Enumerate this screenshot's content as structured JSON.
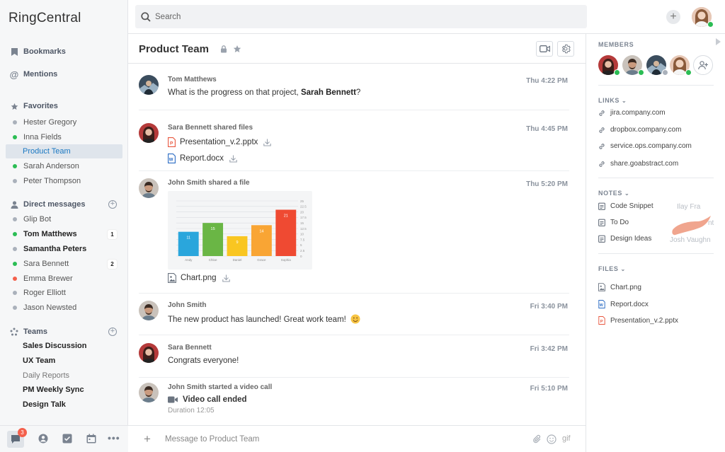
{
  "app": {
    "brand": "RingCentral"
  },
  "search": {
    "placeholder": "Search"
  },
  "sidebar": {
    "bookmarks": "Bookmarks",
    "mentions": "Mentions",
    "favorites": {
      "title": "Favorites",
      "items": [
        {
          "label": "Hester Gregory",
          "status": "gray"
        },
        {
          "label": "Inna Fields",
          "status": "green"
        },
        {
          "label": "Product Team",
          "status": "none",
          "selected": true
        },
        {
          "label": "Sarah Anderson",
          "status": "green"
        },
        {
          "label": "Peter Thompson",
          "status": "gray"
        }
      ]
    },
    "direct": {
      "title": "Direct messages",
      "items": [
        {
          "label": "Glip Bot",
          "status": "gray",
          "bold": false,
          "badge": ""
        },
        {
          "label": "Tom Matthews",
          "status": "green",
          "bold": true,
          "badge": "1"
        },
        {
          "label": "Samantha Peters",
          "status": "gray",
          "bold": true,
          "badge": ""
        },
        {
          "label": "Sara Bennett",
          "status": "green",
          "bold": false,
          "badge": "2"
        },
        {
          "label": "Emma Brewer",
          "status": "red",
          "bold": false,
          "badge": ""
        },
        {
          "label": "Roger Elliott",
          "status": "gray",
          "bold": false,
          "badge": ""
        },
        {
          "label": "Jason Newsted",
          "status": "gray",
          "bold": false,
          "badge": ""
        }
      ]
    },
    "teams": {
      "title": "Teams",
      "items": [
        {
          "label": "Sales Discussion",
          "bold": true
        },
        {
          "label": "UX Team",
          "bold": true
        },
        {
          "label": "Daily Reports",
          "bold": false
        },
        {
          "label": "PM Weekly Sync",
          "bold": true
        },
        {
          "label": "Design Talk",
          "bold": true
        }
      ]
    },
    "bottom_badge": "3"
  },
  "conversation": {
    "title": "Product Team",
    "composer_placeholder": "Message to Product Team",
    "gif_label": "gif",
    "messages": [
      {
        "sender": "Tom Matthews",
        "time": "Thu 4:22 PM",
        "text_before": "What is the progress on that project, ",
        "mention": "Sarah Bennett",
        "text_after": "?"
      },
      {
        "sender": "Sara Bennett shared files",
        "time": "Thu 4:45 PM",
        "files": [
          "Presentation_v.2.pptx",
          "Report.docx"
        ]
      },
      {
        "sender": "John Smith shared a file",
        "time": "Thu 5:20 PM",
        "file": "Chart.png"
      },
      {
        "sender": "John Smith",
        "time": "Fri 3:40 PM",
        "text": "The new product has launched! Great work team!"
      },
      {
        "sender": "Sara Bennett",
        "time": "Fri 3:42 PM",
        "text": "Congrats everyone!"
      },
      {
        "sender": "John Smith started a video call",
        "time": "Fri 5:10 PM",
        "call_title": "Video call ended",
        "call_duration": "Duration 12:05"
      }
    ]
  },
  "chart_data": {
    "type": "bar",
    "categories": [
      "Andy",
      "Chloe",
      "Daniel",
      "Grace",
      "Sophia"
    ],
    "values": [
      11,
      15,
      9,
      14,
      21
    ],
    "colors": [
      "#2aa6dc",
      "#6ab645",
      "#f9c621",
      "#f9a534",
      "#ef4a32"
    ],
    "ylim": [
      0,
      25
    ],
    "yticks": [
      0,
      2.5,
      5,
      7.5,
      10,
      12.5,
      15,
      17.5,
      20,
      22.5,
      25
    ],
    "ytick_labels": [
      "0",
      "2.5",
      "5",
      "7.5",
      "10",
      "12.5",
      "15",
      "17.5",
      "20",
      "22.5",
      "25"
    ]
  },
  "panel": {
    "members_title": "MEMBERS",
    "links_title": "LINKS",
    "links": [
      "jira.company.com",
      "dropbox.company.com",
      "service.ops.company.com",
      "share.goabstract.com"
    ],
    "notes_title": "NOTES",
    "notes": [
      "Code Snippet",
      "To Do",
      "Design Ideas"
    ],
    "notes_ghost": [
      "Ilay Fra",
      "nt",
      "Josh Vaughn"
    ],
    "files_title": "FILES",
    "files": [
      "Chart.png",
      "Report.docx",
      "Presentation_v.2.pptx"
    ]
  }
}
